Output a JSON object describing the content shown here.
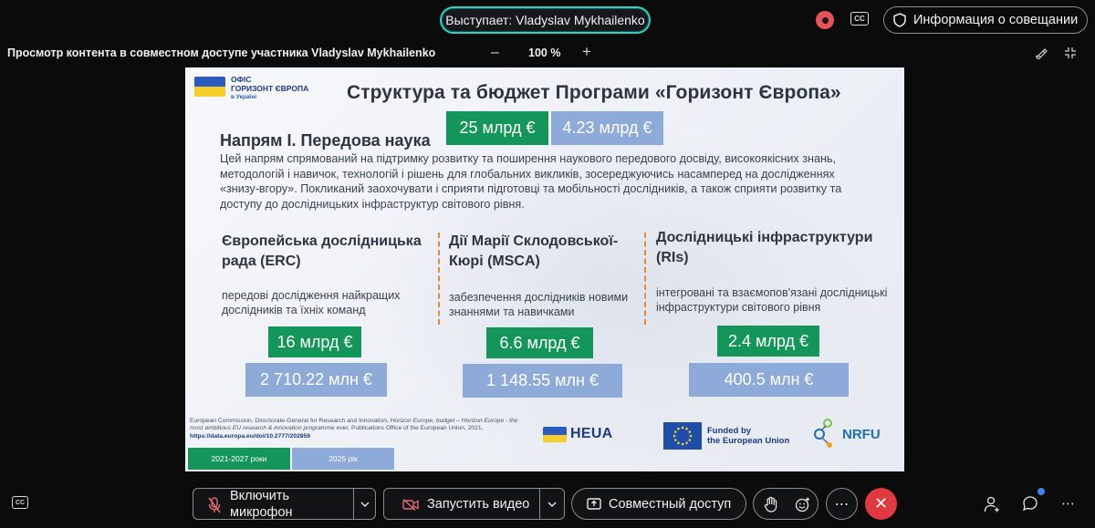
{
  "topbar": {
    "speaker": "Выступает: Vladyslav Mykhailenko",
    "meeting_info": "Информация о совещании"
  },
  "viewbar": {
    "title": "Просмотр контента в совместном доступе участника Vladyslav Mykhailenko",
    "zoom_minus": "–",
    "zoom_level": "100 %",
    "zoom_plus": "+"
  },
  "slide": {
    "logo_line1": "ОФІС",
    "logo_line2": "ГОРИЗОНТ ЄВРОПА",
    "logo_line3": "в Україні",
    "title": "Структура та бюджет Програми «Горизонт Європа»",
    "section_title": "Напрям I. Передова наука",
    "total_green": "25 млрд €",
    "total_blue": "4.23 млрд €",
    "section_desc": "Цей напрям спрямований на підтримку розвитку та поширення наукового передового досвіду, високоякісних знань, методологій і навичок, технологій і рішень для глобальних викликів, зосереджуючись насамперед на дослідженнях «знизу-вгору». Покликаний заохочувати і сприяти підготовці та мобільності дослідників, а також сприяти розвитку та доступу до дослідницьких інфраструктур світового рівня.",
    "columns": [
      {
        "title": "Європейська дослідницька рада (ERC)",
        "text": "передові дослідження найкращих дослідників та їхніх команд",
        "green": "16 млрд €",
        "blue": "2 710.22 млн €"
      },
      {
        "title": "Дії Марії Склодовської-Кюрі (MSCA)",
        "text": "забезпечення дослідників новими знаннями та навичками",
        "green": "6.6 млрд €",
        "blue": "1 148.55 млн €"
      },
      {
        "title": "Дослідницькі інфраструктури (RIs)",
        "text": "інтегровані та взаємопов'язані дослідницькі інфраструктури світового рівня",
        "green": "2.4 млрд €",
        "blue": "400.5 млн €"
      }
    ],
    "footnote_a": "European Commission, Directorate-General for Research and Innovation,",
    "footnote_b": "Horizon Europe, budget – Horizon Europe - the most ambitious EU research & innovation programme ever,",
    "footnote_c": "Publications Office of the European Union, 2021,",
    "footnote_link": "https://data.europa.eu/doi/10.2777/202859",
    "legend_a": "2021-2027 роки",
    "legend_b": "2025 рік",
    "heua": "HEUA",
    "eu_funded_1": "Funded by",
    "eu_funded_2": "the European Union",
    "nrfu": "NRFU"
  },
  "toolbar": {
    "mic_label_1": "Включить",
    "mic_label_2": "микрофон",
    "video_label": "Запустить видео",
    "share_label": "Совместный доступ"
  },
  "colors": {
    "accent_green": "#14955a",
    "accent_blue": "#8eaad8",
    "leave_red": "#e0393f",
    "speaker_border": "#2dd3b5",
    "divider_orange": "#e58a3a"
  },
  "icons": [
    "record-icon",
    "closed-captions-icon",
    "shield-icon",
    "annotate-icon",
    "fit-screen-icon",
    "mic-off-icon",
    "chevron-down-icon",
    "video-off-icon",
    "share-screen-icon",
    "raise-hand-icon",
    "emoji-icon",
    "more-icon",
    "hang-up-icon",
    "participants-icon",
    "chat-icon"
  ]
}
